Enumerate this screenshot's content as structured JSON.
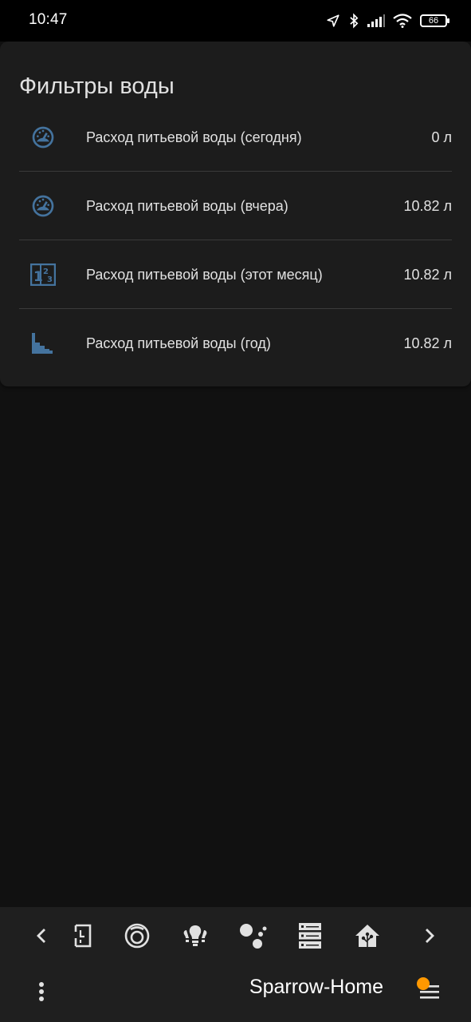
{
  "status_bar": {
    "time": "10:47",
    "battery": "66",
    "icons": [
      "location-arrow-icon",
      "bluetooth-icon",
      "signal-icon",
      "wifi-icon",
      "battery-icon"
    ]
  },
  "card": {
    "title": "Фильтры воды",
    "rows": [
      {
        "icon": "gauge-icon",
        "name": "Расход питьевой воды (сегодня)",
        "value": "0 л"
      },
      {
        "icon": "gauge-icon",
        "name": "Расход питьевой воды (вчера)",
        "value": "10.82 л"
      },
      {
        "icon": "counter-icon",
        "name": "Расход питьевой воды (этот месяц)",
        "value": "10.82 л"
      },
      {
        "icon": "chart-steps-icon",
        "name": "Расход питьевой воды (год)",
        "value": "10.82 л"
      }
    ]
  },
  "bottom_nav": {
    "items": [
      "chevron-left-icon",
      "floor-plan-icon",
      "robot-vacuum-icon",
      "lightbulb-group-icon",
      "google-assistant-icon",
      "server-icon",
      "home-assistant-icon",
      "chevron-right-icon"
    ]
  },
  "app_bar": {
    "title": "Sparrow-Home"
  },
  "colors": {
    "background": "#111111",
    "card": "#1c1c1c",
    "icon_blue": "#44739e",
    "accent_orange": "#ff9800",
    "text": "#e1e1e1"
  }
}
